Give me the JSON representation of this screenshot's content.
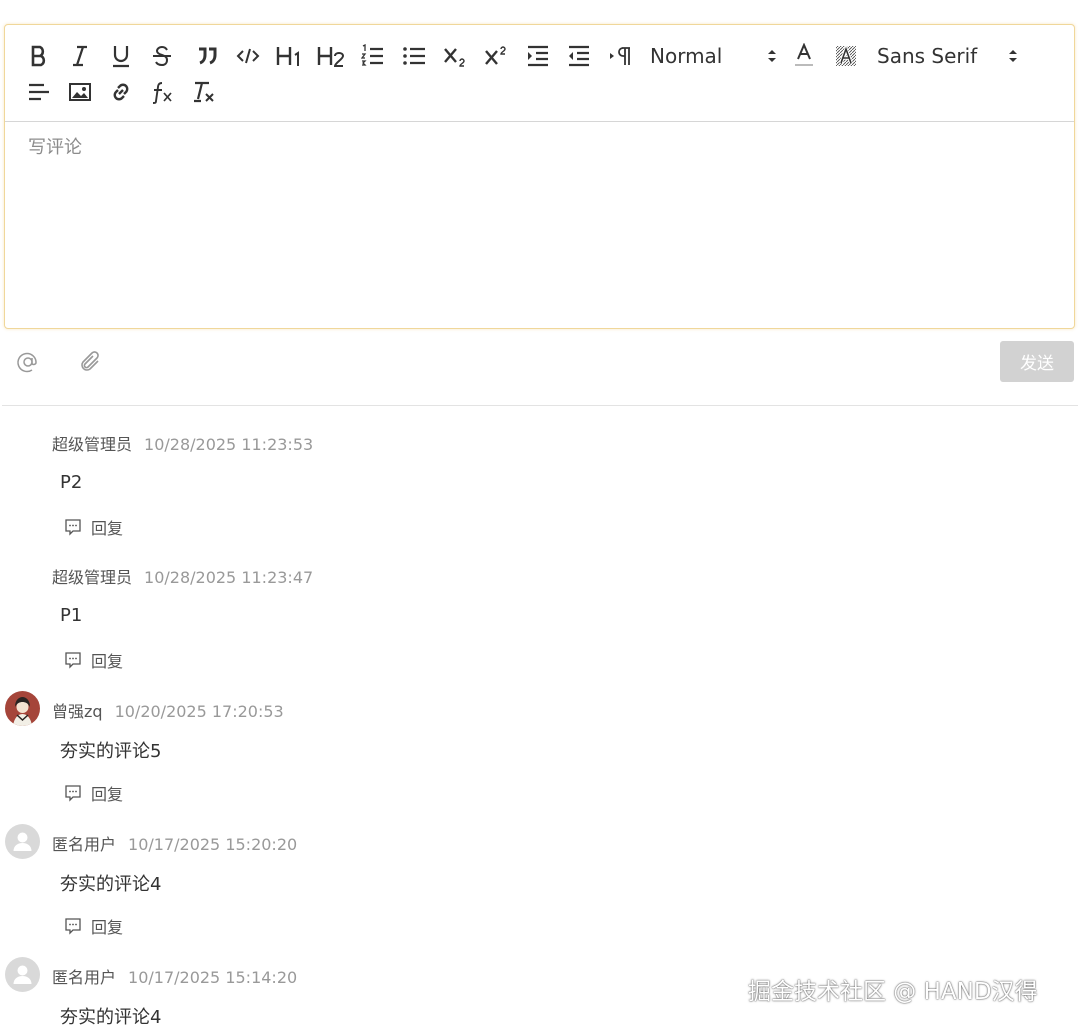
{
  "toolbar": {
    "header_picker": "Normal",
    "font_picker": "Sans Serif"
  },
  "editor": {
    "placeholder": "写评论"
  },
  "actions": {
    "send_label": "发送"
  },
  "comments": [
    {
      "author": "超级管理员",
      "time": "10/28/2025 11:23:53",
      "text": "P2",
      "reply_label": "回复",
      "avatar": "none"
    },
    {
      "author": "超级管理员",
      "time": "10/28/2025 11:23:47",
      "text": "P1",
      "reply_label": "回复",
      "avatar": "none"
    },
    {
      "author": "曾强zq",
      "time": "10/20/2025 17:20:53",
      "text": "夯实的评论5",
      "reply_label": "回复",
      "avatar": "photo"
    },
    {
      "author": "匿名用户",
      "time": "10/17/2025 15:20:20",
      "text": "夯实的评论4",
      "reply_label": "回复",
      "avatar": "default-user-icon"
    },
    {
      "author": "匿名用户",
      "time": "10/17/2025 15:14:20",
      "text": "夯实的评论4",
      "reply_label": "回复",
      "avatar": "default-user-icon"
    }
  ],
  "watermark": "掘金技术社区 @ HAND汉得"
}
